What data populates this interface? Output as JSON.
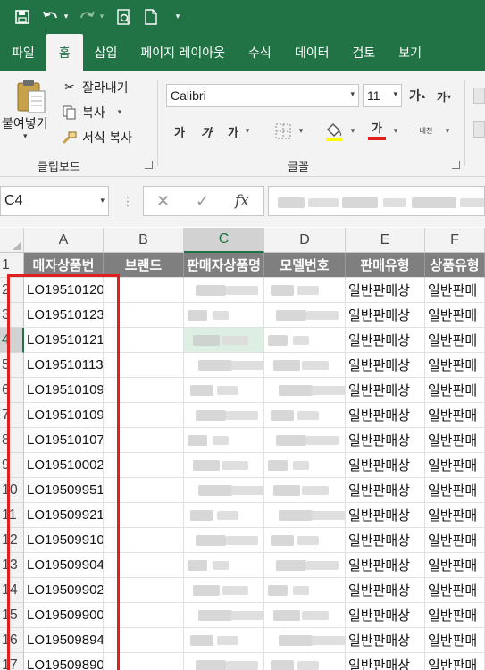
{
  "quick_access": {
    "save_icon": "save-icon",
    "undo_icon": "undo-icon",
    "redo_icon": "redo-icon",
    "print_preview_icon": "print-preview-icon",
    "new_file_icon": "new-file-icon",
    "customize_icon": "customize-icon"
  },
  "tabs": [
    "파일",
    "홈",
    "삽입",
    "페이지 레이아웃",
    "수식",
    "데이터",
    "검토",
    "보기"
  ],
  "active_tab": "홈",
  "clipboard": {
    "paste_label": "붙여넣기",
    "cut_label": "잘라내기",
    "copy_label": "복사",
    "format_painter_label": "서식 복사",
    "group_label": "클립보드"
  },
  "font": {
    "name": "Calibri",
    "size": "11",
    "bold": "가",
    "italic": "가",
    "underline": "가",
    "font_color_sample": "가",
    "phonetic": "내천",
    "group_label": "글꼴",
    "increase_size": "가",
    "decrease_size": "가"
  },
  "formula_bar": {
    "name_box": "C4",
    "cancel": "✕",
    "enter": "✓",
    "fx": "fx",
    "content": ""
  },
  "columns": [
    "A",
    "B",
    "C",
    "D",
    "E",
    "F"
  ],
  "selected_column": "C",
  "rows": [
    "1",
    "2",
    "3",
    "4",
    "5",
    "6",
    "7",
    "8",
    "9",
    "10",
    "11",
    "12",
    "13",
    "14",
    "15",
    "16",
    "17"
  ],
  "selected_row": "4",
  "header_row": [
    "매자상품번",
    "브랜드",
    "판매자상품명",
    "모델번호",
    "판매유형",
    "상품유형"
  ],
  "column_a": [
    "LO19510120",
    "LO19510123",
    "LO19510121",
    "LO19510113",
    "LO19510109",
    "LO19510109",
    "LO19510107",
    "LO19510002",
    "LO19509951",
    "LO19509921",
    "LO19509910",
    "LO19509904",
    "LO19509902",
    "LO19509900",
    "LO19509894",
    "LO19509890"
  ],
  "column_e_value": "일반판매상",
  "column_f_value": "일반판매",
  "colors": {
    "excel_green": "#217346",
    "header_fill": "#7f7f7f",
    "highlight_box": "#e02020"
  }
}
